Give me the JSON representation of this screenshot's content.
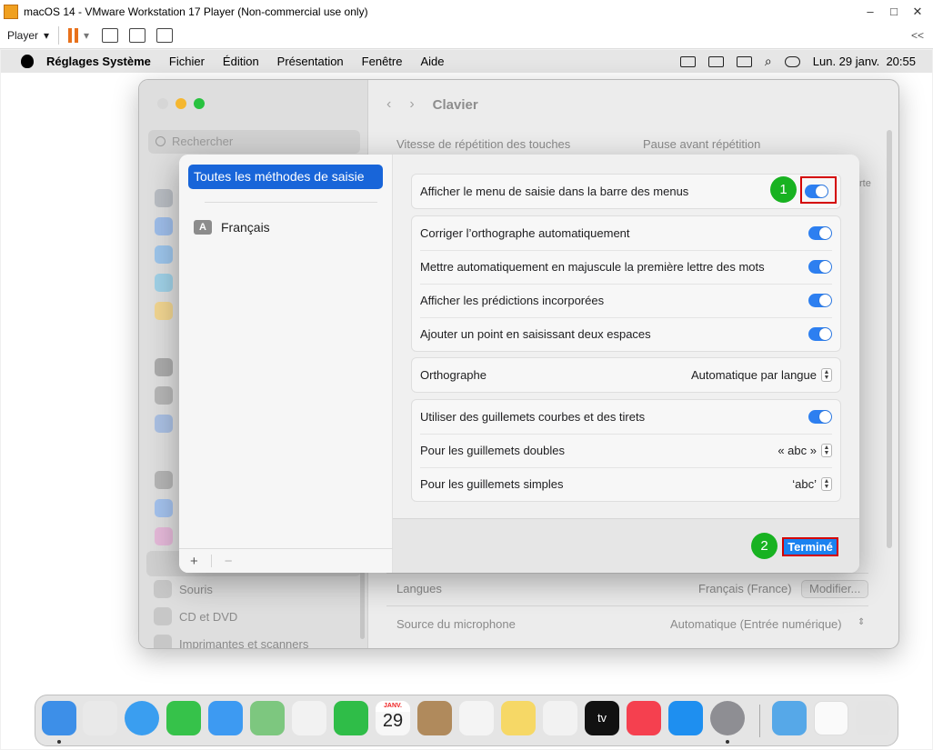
{
  "vmware": {
    "title": "macOS 14 - VMware Workstation 17 Player (Non-commercial use only)",
    "player_label": "Player",
    "window_controls": [
      "–",
      "□",
      "✕"
    ],
    "collapse_label": "<<"
  },
  "menubar": {
    "app_name": "Réglages Système",
    "items": [
      "Fichier",
      "Édition",
      "Présentation",
      "Fenêtre",
      "Aide"
    ],
    "datetime": "Lun. 29 janv.  20:55"
  },
  "settings_window": {
    "search_placeholder": "Rechercher",
    "nav_title": "Clavier",
    "sidebar_items": [
      "Souris",
      "CD et DVD",
      "Imprimantes et scanners"
    ],
    "key_repeat_label": "Vitesse de répétition des touches",
    "delay_label": "Pause avant répétition",
    "partial_text": "rte",
    "languages_label": "Langues",
    "languages_value": "Français (France)",
    "modify_button": "Modifier...",
    "mic_source_label": "Source du microphone",
    "mic_source_value": "Automatique (Entrée numérique)"
  },
  "sheet": {
    "methods": {
      "all_label": "Toutes les méthodes de saisie",
      "french_badge": "A",
      "french_label": "Français"
    },
    "footer": {
      "add": "+",
      "remove": "−"
    },
    "options": {
      "show_input_menu": "Afficher le menu de saisie dans la barre des menus",
      "autocorrect": "Corriger l’orthographe automatiquement",
      "autocapitalize": "Mettre automatiquement en majuscule la première lettre des mots",
      "inline_predictions": "Afficher les prédictions incorporées",
      "double_space_period": "Ajouter un point en saisissant deux espaces",
      "spelling_label": "Orthographe",
      "spelling_value": "Automatique par langue",
      "smart_quotes": "Utiliser des guillemets courbes et des tirets",
      "double_quotes_label": "Pour les guillemets doubles",
      "double_quotes_value": "« abc »",
      "single_quotes_label": "Pour les guillemets simples",
      "single_quotes_value": "‘abc’"
    },
    "toggles": {
      "show_input_menu": true,
      "autocorrect": true,
      "autocapitalize": true,
      "inline_predictions": true,
      "double_space_period": true,
      "smart_quotes": true
    },
    "done_button": "Terminé"
  },
  "annotations": {
    "step1": "1",
    "step2": "2"
  },
  "dock": {
    "calendar_month": "JANV.",
    "calendar_day": "29",
    "tv_label": "tv"
  }
}
